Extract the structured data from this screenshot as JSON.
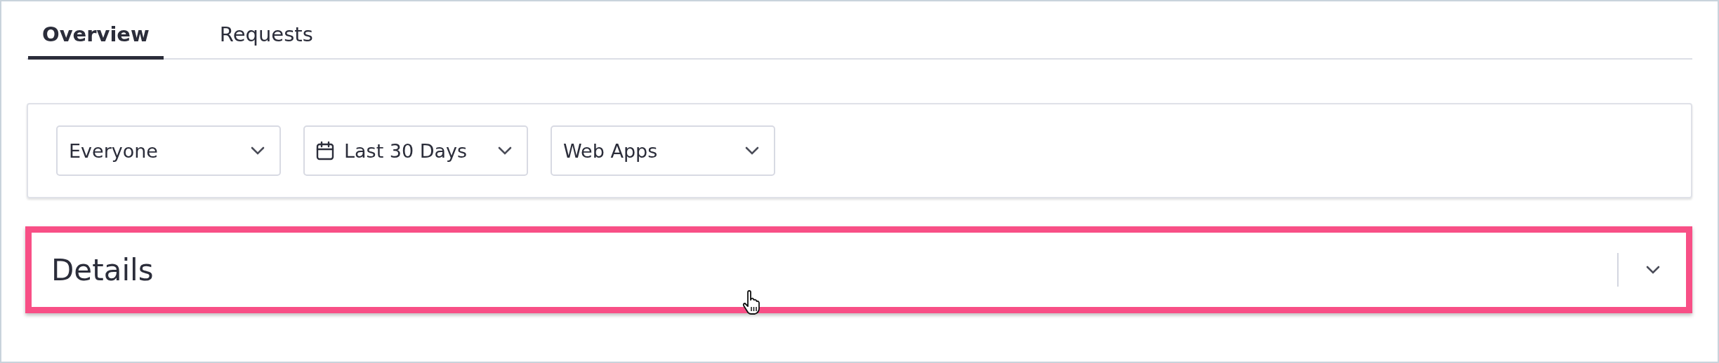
{
  "tabs": [
    {
      "label": "Overview",
      "selected": true
    },
    {
      "label": "Requests",
      "selected": false
    }
  ],
  "filters": [
    {
      "kind": "select",
      "value": "Everyone"
    },
    {
      "kind": "date",
      "value": "Last 30 Days"
    },
    {
      "kind": "select",
      "value": "Web Apps"
    }
  ],
  "details": {
    "title": "Details",
    "expanded": false,
    "highlighted": true
  }
}
